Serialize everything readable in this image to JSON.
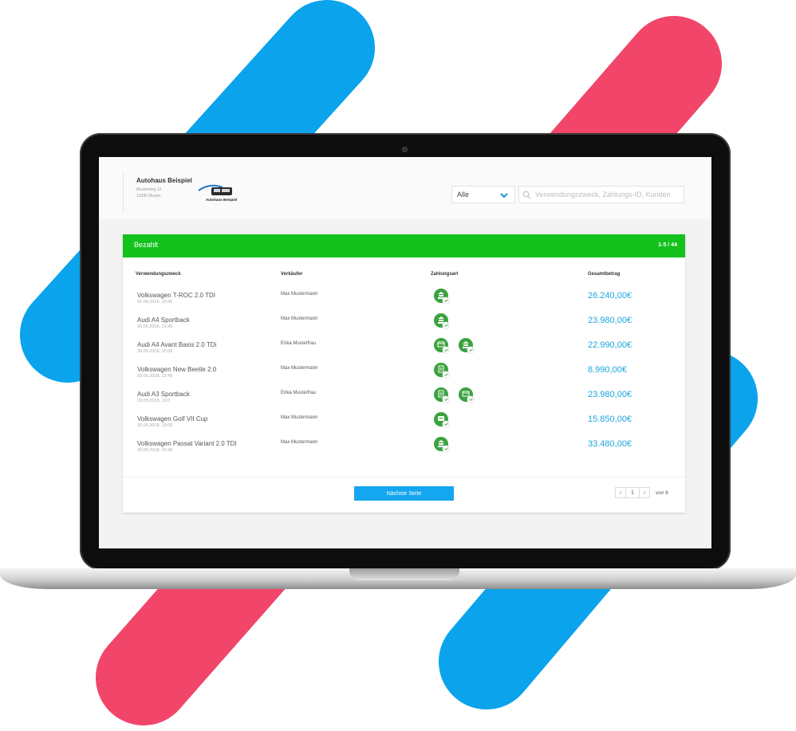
{
  "colors": {
    "stripe_blue": "#0aa3ec",
    "stripe_pink": "#f2456a",
    "accent_green": "#13c21c",
    "amount_blue": "#1ba6dd",
    "button_blue": "#14a6ee"
  },
  "header": {
    "company_name": "Autohaus Beispiel",
    "address_line1": "Musterweg 12",
    "address_line2": "12345 Muster",
    "logo_text": "Autohaus Beispiel",
    "filter_value": "Alle",
    "search_placeholder": "Verwendungszweck, Zahlungs-ID, Kunden"
  },
  "table": {
    "title": "Bezahlt",
    "range": "1-5 / 44",
    "columns": [
      "Verwendungszweck",
      "Verkäufer",
      "Zahlungsart",
      "Gesamtbetrag"
    ],
    "rows": [
      {
        "purpose": "Volkswagen T-ROC 2.0 TDI",
        "date": "01.06.2018, 10:45",
        "seller": "Max Mustermann",
        "payment_icons": [
          "bank-transfer-icon"
        ],
        "amount": "26.240,00€"
      },
      {
        "purpose": "Audi A4 Sportback",
        "date": "30.05.2018, 13:45",
        "seller": "Max Mustermann",
        "payment_icons": [
          "bank-transfer-icon"
        ],
        "amount": "23.980,00€"
      },
      {
        "purpose": "Audi A4 Avant Basis 2.0 TDi",
        "date": "30.05.2018, 10:00",
        "seller": "Erika Musterfrau",
        "payment_icons": [
          "card-payment-icon",
          "bank-transfer-icon"
        ],
        "amount": "22.990,00€"
      },
      {
        "purpose": "Volkswagen New Beetle 2.0",
        "date": "29.05.2018, 13:45",
        "seller": "Max Mustermann",
        "payment_icons": [
          "invoice-icon"
        ],
        "amount": "8.990,00€"
      },
      {
        "purpose": "Audi A3 Sportback",
        "date": "29.05.2018, 10:0",
        "seller": "Erika Musterfrau",
        "payment_icons": [
          "invoice-icon",
          "card-payment-icon"
        ],
        "amount": "23.980,00€"
      },
      {
        "purpose": "Volkswagen Golf VII Cup",
        "date": "30.05.2018, 10:00",
        "seller": "Max Mustermann",
        "payment_icons": [
          "card-icon"
        ],
        "amount": "15.850,00€"
      },
      {
        "purpose": "Volkswagen Passat Variant 2.0 TDI",
        "date": "29.05.2018, 13:45",
        "seller": "Max Mustermann",
        "payment_icons": [
          "bank-transfer-icon"
        ],
        "amount": "33.480,00€"
      }
    ]
  },
  "footer": {
    "next_button": "Nächste Seite",
    "prev_symbol": "‹",
    "page": "1",
    "next_symbol": "›",
    "total": "von 6"
  }
}
